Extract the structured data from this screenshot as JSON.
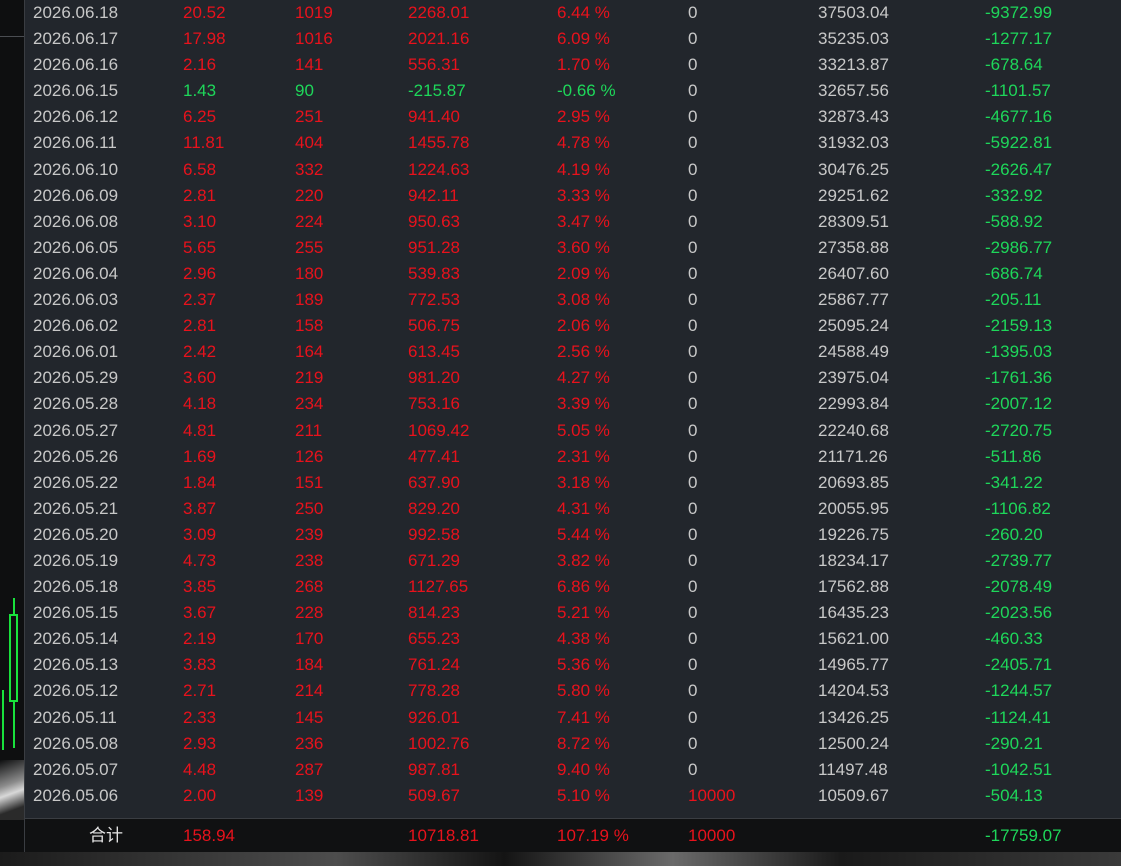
{
  "rows": [
    {
      "date": "2026.06.18",
      "a": "20.52",
      "b": "1019",
      "c": "2268.01",
      "d": "6.44 %",
      "e": "0",
      "f": "37503.04",
      "g": "-9372.99",
      "cls": "red"
    },
    {
      "date": "2026.06.17",
      "a": "17.98",
      "b": "1016",
      "c": "2021.16",
      "d": "6.09 %",
      "e": "0",
      "f": "35235.03",
      "g": "-1277.17",
      "cls": "red"
    },
    {
      "date": "2026.06.16",
      "a": "2.16",
      "b": "141",
      "c": "556.31",
      "d": "1.70 %",
      "e": "0",
      "f": "33213.87",
      "g": "-678.64",
      "cls": "red"
    },
    {
      "date": "2026.06.15",
      "a": "1.43",
      "b": "90",
      "c": "-215.87",
      "d": "-0.66 %",
      "e": "0",
      "f": "32657.56",
      "g": "-1101.57",
      "cls": "green"
    },
    {
      "date": "2026.06.12",
      "a": "6.25",
      "b": "251",
      "c": "941.40",
      "d": "2.95 %",
      "e": "0",
      "f": "32873.43",
      "g": "-4677.16",
      "cls": "red"
    },
    {
      "date": "2026.06.11",
      "a": "11.81",
      "b": "404",
      "c": "1455.78",
      "d": "4.78 %",
      "e": "0",
      "f": "31932.03",
      "g": "-5922.81",
      "cls": "red"
    },
    {
      "date": "2026.06.10",
      "a": "6.58",
      "b": "332",
      "c": "1224.63",
      "d": "4.19 %",
      "e": "0",
      "f": "30476.25",
      "g": "-2626.47",
      "cls": "red"
    },
    {
      "date": "2026.06.09",
      "a": "2.81",
      "b": "220",
      "c": "942.11",
      "d": "3.33 %",
      "e": "0",
      "f": "29251.62",
      "g": "-332.92",
      "cls": "red"
    },
    {
      "date": "2026.06.08",
      "a": "3.10",
      "b": "224",
      "c": "950.63",
      "d": "3.47 %",
      "e": "0",
      "f": "28309.51",
      "g": "-588.92",
      "cls": "red"
    },
    {
      "date": "2026.06.05",
      "a": "5.65",
      "b": "255",
      "c": "951.28",
      "d": "3.60 %",
      "e": "0",
      "f": "27358.88",
      "g": "-2986.77",
      "cls": "red"
    },
    {
      "date": "2026.06.04",
      "a": "2.96",
      "b": "180",
      "c": "539.83",
      "d": "2.09 %",
      "e": "0",
      "f": "26407.60",
      "g": "-686.74",
      "cls": "red"
    },
    {
      "date": "2026.06.03",
      "a": "2.37",
      "b": "189",
      "c": "772.53",
      "d": "3.08 %",
      "e": "0",
      "f": "25867.77",
      "g": "-205.11",
      "cls": "red"
    },
    {
      "date": "2026.06.02",
      "a": "2.81",
      "b": "158",
      "c": "506.75",
      "d": "2.06 %",
      "e": "0",
      "f": "25095.24",
      "g": "-2159.13",
      "cls": "red"
    },
    {
      "date": "2026.06.01",
      "a": "2.42",
      "b": "164",
      "c": "613.45",
      "d": "2.56 %",
      "e": "0",
      "f": "24588.49",
      "g": "-1395.03",
      "cls": "red"
    },
    {
      "date": "2026.05.29",
      "a": "3.60",
      "b": "219",
      "c": "981.20",
      "d": "4.27 %",
      "e": "0",
      "f": "23975.04",
      "g": "-1761.36",
      "cls": "red"
    },
    {
      "date": "2026.05.28",
      "a": "4.18",
      "b": "234",
      "c": "753.16",
      "d": "3.39 %",
      "e": "0",
      "f": "22993.84",
      "g": "-2007.12",
      "cls": "red"
    },
    {
      "date": "2026.05.27",
      "a": "4.81",
      "b": "211",
      "c": "1069.42",
      "d": "5.05 %",
      "e": "0",
      "f": "22240.68",
      "g": "-2720.75",
      "cls": "red"
    },
    {
      "date": "2026.05.26",
      "a": "1.69",
      "b": "126",
      "c": "477.41",
      "d": "2.31 %",
      "e": "0",
      "f": "21171.26",
      "g": "-511.86",
      "cls": "red"
    },
    {
      "date": "2026.05.22",
      "a": "1.84",
      "b": "151",
      "c": "637.90",
      "d": "3.18 %",
      "e": "0",
      "f": "20693.85",
      "g": "-341.22",
      "cls": "red"
    },
    {
      "date": "2026.05.21",
      "a": "3.87",
      "b": "250",
      "c": "829.20",
      "d": "4.31 %",
      "e": "0",
      "f": "20055.95",
      "g": "-1106.82",
      "cls": "red"
    },
    {
      "date": "2026.05.20",
      "a": "3.09",
      "b": "239",
      "c": "992.58",
      "d": "5.44 %",
      "e": "0",
      "f": "19226.75",
      "g": "-260.20",
      "cls": "red"
    },
    {
      "date": "2026.05.19",
      "a": "4.73",
      "b": "238",
      "c": "671.29",
      "d": "3.82 %",
      "e": "0",
      "f": "18234.17",
      "g": "-2739.77",
      "cls": "red"
    },
    {
      "date": "2026.05.18",
      "a": "3.85",
      "b": "268",
      "c": "1127.65",
      "d": "6.86 %",
      "e": "0",
      "f": "17562.88",
      "g": "-2078.49",
      "cls": "red"
    },
    {
      "date": "2026.05.15",
      "a": "3.67",
      "b": "228",
      "c": "814.23",
      "d": "5.21 %",
      "e": "0",
      "f": "16435.23",
      "g": "-2023.56",
      "cls": "red"
    },
    {
      "date": "2026.05.14",
      "a": "2.19",
      "b": "170",
      "c": "655.23",
      "d": "4.38 %",
      "e": "0",
      "f": "15621.00",
      "g": "-460.33",
      "cls": "red"
    },
    {
      "date": "2026.05.13",
      "a": "3.83",
      "b": "184",
      "c": "761.24",
      "d": "5.36 %",
      "e": "0",
      "f": "14965.77",
      "g": "-2405.71",
      "cls": "red"
    },
    {
      "date": "2026.05.12",
      "a": "2.71",
      "b": "214",
      "c": "778.28",
      "d": "5.80 %",
      "e": "0",
      "f": "14204.53",
      "g": "-1244.57",
      "cls": "red"
    },
    {
      "date": "2026.05.11",
      "a": "2.33",
      "b": "145",
      "c": "926.01",
      "d": "7.41 %",
      "e": "0",
      "f": "13426.25",
      "g": "-1124.41",
      "cls": "red"
    },
    {
      "date": "2026.05.08",
      "a": "2.93",
      "b": "236",
      "c": "1002.76",
      "d": "8.72 %",
      "e": "0",
      "f": "12500.24",
      "g": "-290.21",
      "cls": "red"
    },
    {
      "date": "2026.05.07",
      "a": "4.48",
      "b": "287",
      "c": "987.81",
      "d": "9.40 %",
      "e": "0",
      "f": "11497.48",
      "g": "-1042.51",
      "cls": "red"
    },
    {
      "date": "2026.05.06",
      "a": "2.00",
      "b": "139",
      "c": "509.67",
      "d": "5.10 %",
      "e": "10000",
      "f": "10509.67",
      "g": "-504.13",
      "cls": "red",
      "e_red": true
    }
  ],
  "total": {
    "label": "合计",
    "a": "158.94",
    "c": "10718.81",
    "d": "107.19 %",
    "e": "10000",
    "g": "-17759.07"
  },
  "colors": {
    "up": "#e8121c",
    "down": "#1ed75a",
    "text": "#c8c8c8",
    "bg": "#22262c"
  }
}
